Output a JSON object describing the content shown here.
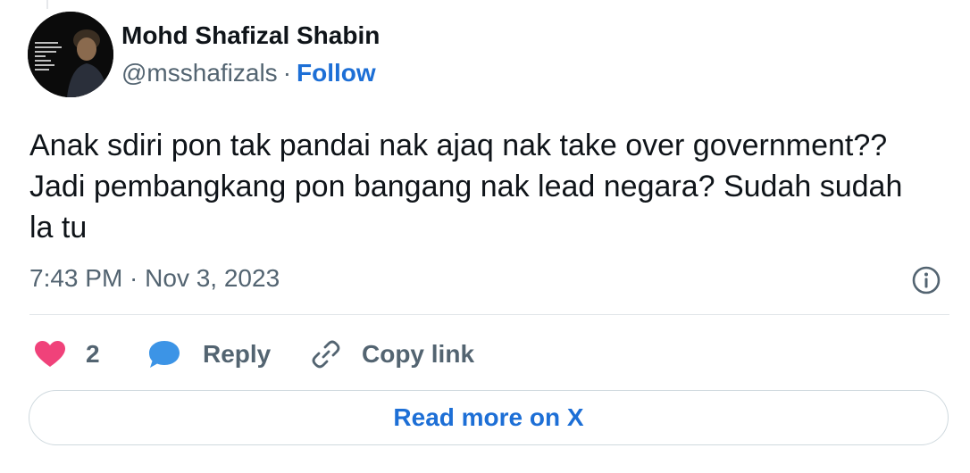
{
  "author": {
    "name": "Mohd Shafizal Shabin",
    "handle": "@msshafizals",
    "separator": "·",
    "follow_label": "Follow"
  },
  "tweet": {
    "text": "Anak sdiri pon tak pandai nak ajaq nak take over government?? Jadi pembangkang pon bangang nak lead negara? Sudah sudah la tu",
    "timestamp": "7:43 PM · Nov 3, 2023"
  },
  "actions": {
    "like_count": "2",
    "reply_label": "Reply",
    "copy_link_label": "Copy link"
  },
  "footer": {
    "read_more_label": "Read more on X"
  },
  "icons": {
    "heart": "heart-icon",
    "reply": "speech-bubble-icon",
    "copy_link": "link-icon",
    "info": "info-icon"
  },
  "colors": {
    "link_blue": "#1d6fd6",
    "heart_pink": "#f0427a",
    "reply_blue": "#3c94e6",
    "muted_gray": "#536471",
    "text_dark": "#0f1419"
  }
}
